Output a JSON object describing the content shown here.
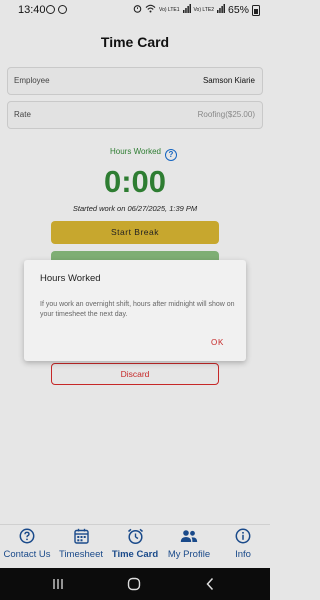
{
  "status_bar": {
    "time": "13:40",
    "battery": "65%",
    "net1": "Vo) LTE1",
    "net2": "Vo) LTE2"
  },
  "header": {
    "title": "Time Card"
  },
  "employee": {
    "label": "Employee",
    "value": "Samson Kiarie"
  },
  "rate": {
    "label": "Rate",
    "value": "Roofing($25.00)"
  },
  "hours": {
    "label": "Hours Worked",
    "timer": "0:00",
    "started": "Started work on 06/27/2025, 1:39 PM"
  },
  "buttons": {
    "start_break": "Start Break",
    "discard": "Discard"
  },
  "dialog": {
    "title": "Hours Worked",
    "message": "If you work an overnight shift, hours after midnight will show on your timesheet the next day.",
    "ok": "OK"
  },
  "nav": {
    "items": [
      {
        "label": "Contact Us",
        "icon": "help-circle-icon"
      },
      {
        "label": "Timesheet",
        "icon": "calendar-icon"
      },
      {
        "label": "Time Card",
        "icon": "clock-icon",
        "active": true
      },
      {
        "label": "My Profile",
        "icon": "people-icon"
      },
      {
        "label": "Info",
        "icon": "info-icon"
      }
    ]
  },
  "colors": {
    "accent_green": "#2e7d32",
    "break_yellow": "#c7a72e",
    "discard_red": "#c62828",
    "nav_blue": "#1a4a8a"
  }
}
